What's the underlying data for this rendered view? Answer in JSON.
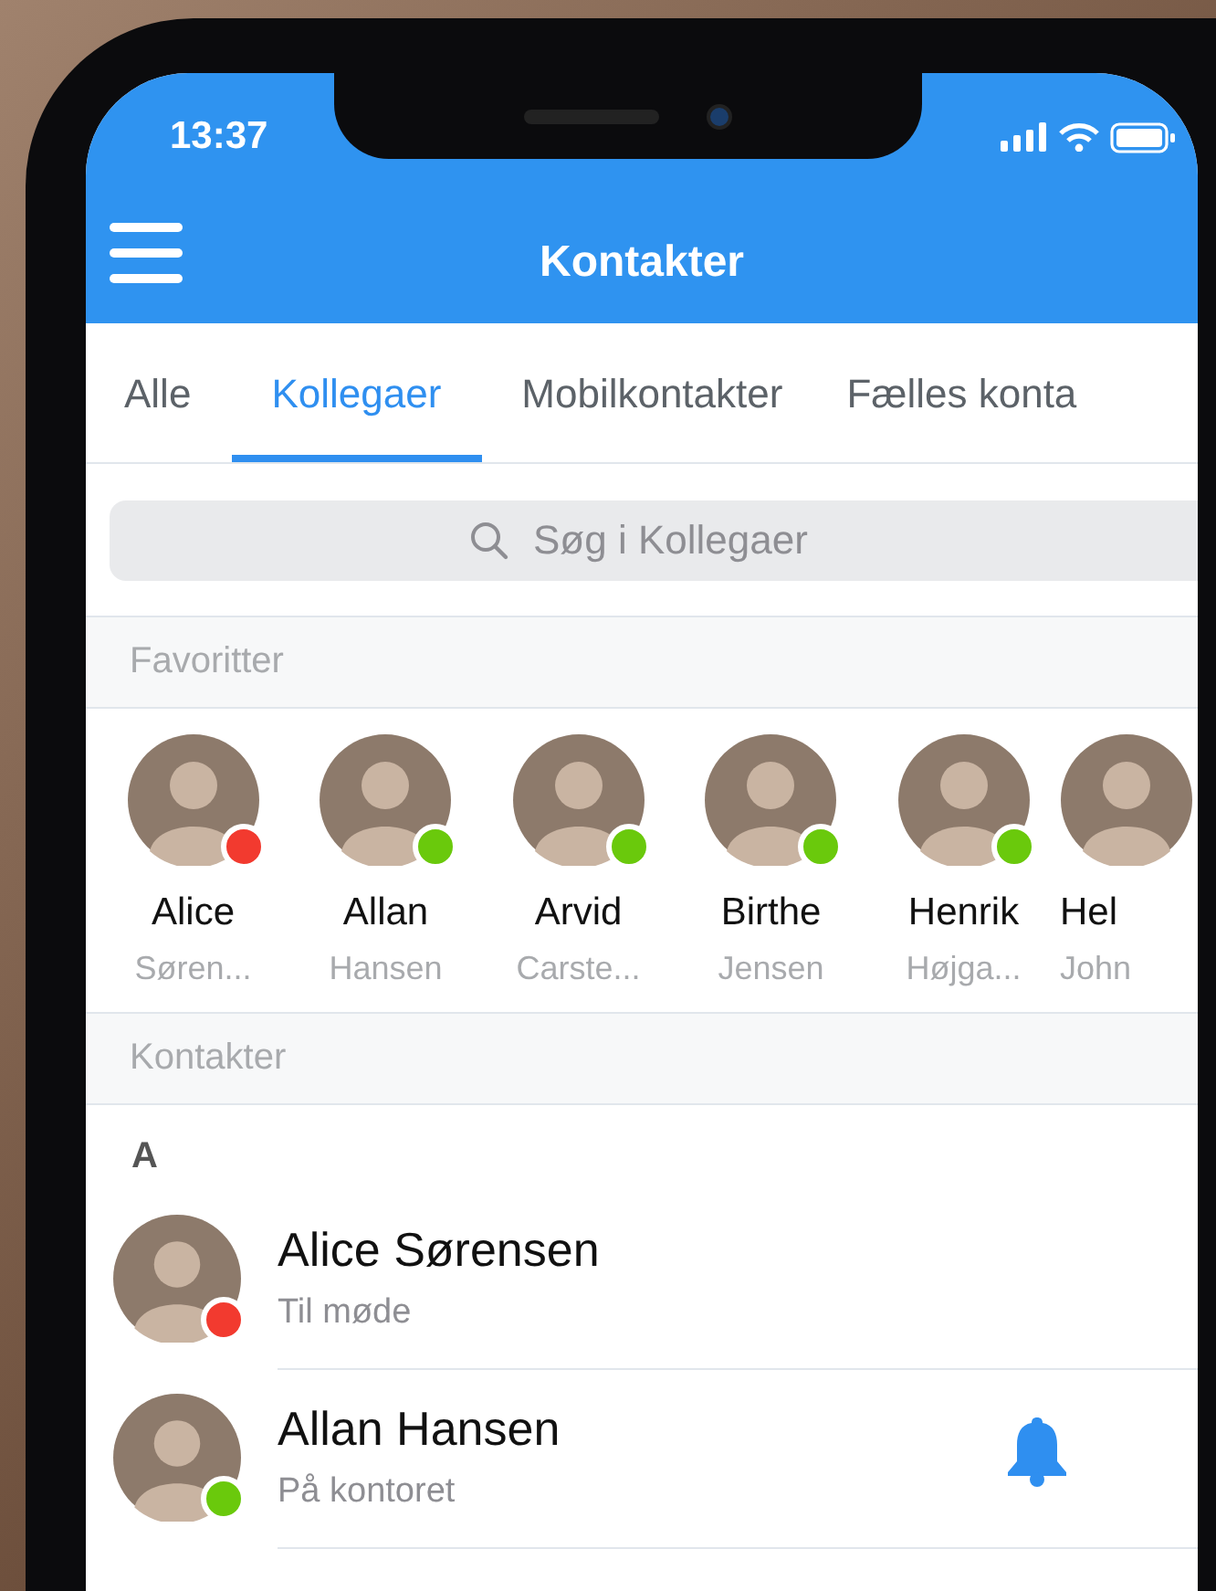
{
  "status_bar": {
    "time": "13:37"
  },
  "header": {
    "title": "Kontakter"
  },
  "tabs": [
    {
      "label": "Alle",
      "selected": false
    },
    {
      "label": "Kollegaer",
      "selected": true
    },
    {
      "label": "Mobilkontakter",
      "selected": false
    },
    {
      "label": "Fælles konta",
      "selected": false
    }
  ],
  "search": {
    "placeholder": "Søg i Kollegaer"
  },
  "favorites": {
    "heading": "Favoritter",
    "items": [
      {
        "first_name": "Alice",
        "last_name": "Søren...",
        "color": "#f23a2f"
      },
      {
        "first_name": "Allan",
        "last_name": "Hansen",
        "color": "#6ac90c"
      },
      {
        "first_name": "Arvid",
        "last_name": "Carste...",
        "color": "#6ac90c"
      },
      {
        "first_name": "Birthe",
        "last_name": "Jensen",
        "color": "#6ac90c"
      },
      {
        "first_name": "Henrik",
        "last_name": "Højga...",
        "color": "#6ac90c"
      },
      {
        "first_name": "Hel",
        "last_name": "John"
      }
    ]
  },
  "contacts": {
    "heading": "Kontakter",
    "groups": [
      {
        "letter": "A",
        "rows": [
          {
            "name": "Alice Sørensen",
            "status": "Til møde",
            "color": "#f23a2f",
            "bell": false
          },
          {
            "name": "Allan Hansen",
            "status": "På kontoret",
            "color": "#6ac90c",
            "bell": true
          }
        ]
      }
    ]
  }
}
